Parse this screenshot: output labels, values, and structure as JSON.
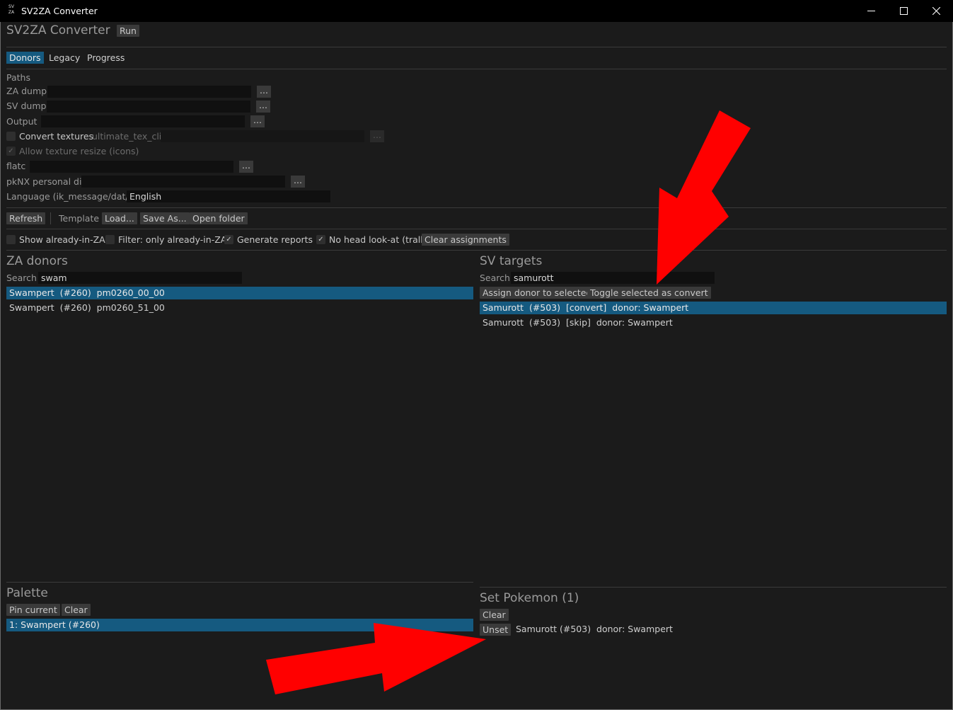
{
  "window": {
    "title": "SV2ZA Converter",
    "logo_text": "SV ZA",
    "controls": {
      "minimize": "—",
      "maximize": "☐",
      "close": "✕"
    }
  },
  "header": {
    "title": "SV2ZA Converter",
    "run_label": "Run"
  },
  "tabs": [
    {
      "label": "Donors",
      "active": true
    },
    {
      "label": "Legacy",
      "active": false
    },
    {
      "label": "Progress",
      "active": false
    }
  ],
  "paths": {
    "heading": "Paths",
    "za_dump_label": "ZA dump",
    "za_dump_value": "",
    "sv_dump_label": "SV dump",
    "sv_dump_value": "",
    "output_label": "Output",
    "output_value": "",
    "convert_textures_label": "Convert textures",
    "convert_textures_tool": "ultimate_tex_cli",
    "convert_textures_value": "",
    "allow_resize_label": "Allow texture resize (icons)",
    "flatc_label": "flatc",
    "flatc_value": "",
    "pknx_label": "pkNX personal dir",
    "pknx_value": "",
    "language_label": "Language (ik_message/dat/...)",
    "language_value": "English",
    "browse_label": "..."
  },
  "toolbar": {
    "refresh_label": "Refresh",
    "template_label": "Template",
    "load_label": "Load...",
    "save_as_label": "Save As...",
    "open_folder_label": "Open folder"
  },
  "options": {
    "show_already_label": "Show already-in-ZA",
    "filter_only_label": "Filter: only already-in-ZA",
    "generate_reports_label": "Generate reports",
    "no_head_label": "No head look-at (tralk)",
    "clear_assignments_label": "Clear assignments",
    "check_mark": "✓"
  },
  "za_donors": {
    "title": "ZA donors",
    "search_label": "Search",
    "search_value": "swam",
    "items": [
      {
        "text": "Swampert  (#260)  pm0260_00_00",
        "selected": true
      },
      {
        "text": "Swampert  (#260)  pm0260_51_00",
        "selected": false
      }
    ]
  },
  "sv_targets": {
    "title": "SV targets",
    "search_label": "Search",
    "search_value": "samurott",
    "assign_label": "Assign donor to selected",
    "toggle_label": "Toggle selected as convert",
    "items": [
      {
        "text": "Samurott  (#503)  [convert]  donor: Swampert",
        "selected": true
      },
      {
        "text": "Samurott  (#503)  [skip]  donor: Swampert",
        "selected": false
      }
    ]
  },
  "palette": {
    "title": "Palette",
    "pin_label": "Pin current",
    "clear_label": "Clear",
    "items": [
      {
        "text": "1: Swampert (#260)",
        "selected": true
      }
    ]
  },
  "set_pokemon": {
    "title": "Set Pokemon (1)",
    "clear_label": "Clear",
    "unset_label": "Unset",
    "entry_text": "Samurott (#503)  donor: Swampert"
  },
  "colors": {
    "accent": "#155a80",
    "arrow": "#ff0000",
    "background": "#1b1b1b"
  }
}
